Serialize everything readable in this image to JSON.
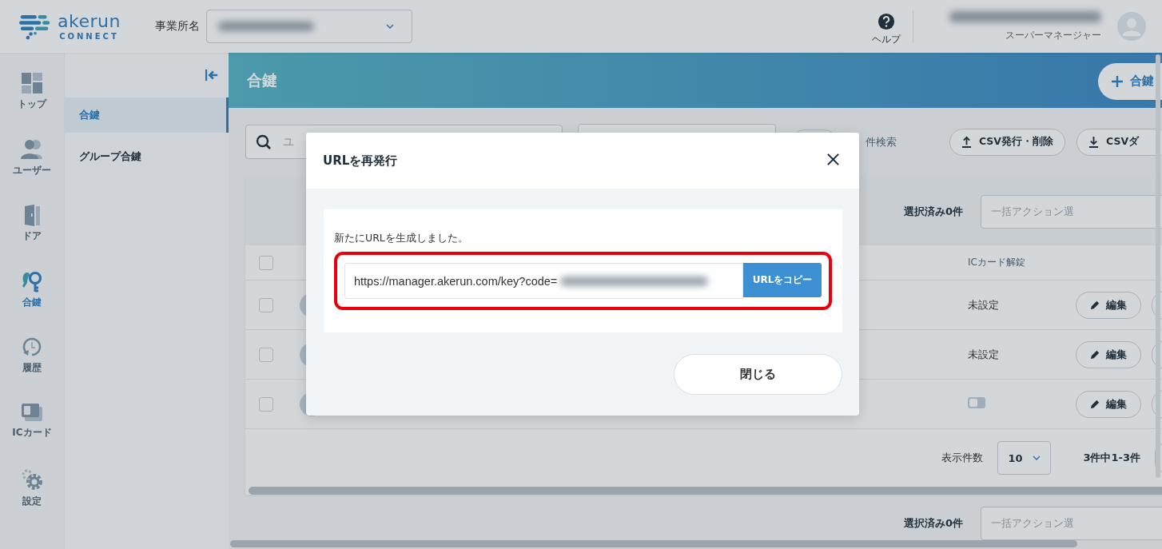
{
  "header": {
    "logo_name": "akerun",
    "logo_sub": "CONNECT",
    "office_label": "事業所名",
    "help_label": "ヘルプ",
    "user_role": "スーパーマネージャー"
  },
  "nav_rail": [
    {
      "label": "トップ",
      "selected": false
    },
    {
      "label": "ユーザー",
      "selected": false
    },
    {
      "label": "ドア",
      "selected": false
    },
    {
      "label": "合鍵",
      "selected": true
    },
    {
      "label": "履歴",
      "selected": false
    },
    {
      "label": "ICカード",
      "selected": false
    },
    {
      "label": "設定",
      "selected": false
    }
  ],
  "sub_sidebar": [
    {
      "label": "合鍵",
      "selected": true
    },
    {
      "label": "グループ合鍵",
      "selected": false
    }
  ],
  "page": {
    "title": "合鍵",
    "add_button": "合鍵",
    "search_placeholder": "ユ",
    "search_link": "件検索",
    "csv_buttons": [
      "CSV発行・削除",
      "CSVダ"
    ]
  },
  "table": {
    "selected_count": "選択済み0件",
    "bulk_placeholder": "一括アクション選",
    "ic_column": "ICカード解錠",
    "select_all_checked": false,
    "rows": [
      {
        "checked": false,
        "ic_unlock": {
          "kind": "text",
          "text": "未設定"
        },
        "edit": "編集"
      },
      {
        "checked": false,
        "ic_unlock": {
          "kind": "text",
          "text": "未設定"
        },
        "edit": "編集"
      },
      {
        "checked": false,
        "ic_unlock": {
          "kind": "toggle",
          "on": false
        },
        "edit": "編集"
      }
    ],
    "per_page_label": "表示件数",
    "per_page": "10",
    "range": "3件中1-3件"
  },
  "bottom_bar": {
    "selected_count": "選択済み0件",
    "bulk_placeholder": "一括アクション選"
  },
  "dialog": {
    "title": "URLを再発行",
    "message": "新たにURLを生成しました。",
    "url": "https://manager.akerun.com/key?code=",
    "copy_button": "URLをコピー",
    "close_button": "閉じる"
  }
}
